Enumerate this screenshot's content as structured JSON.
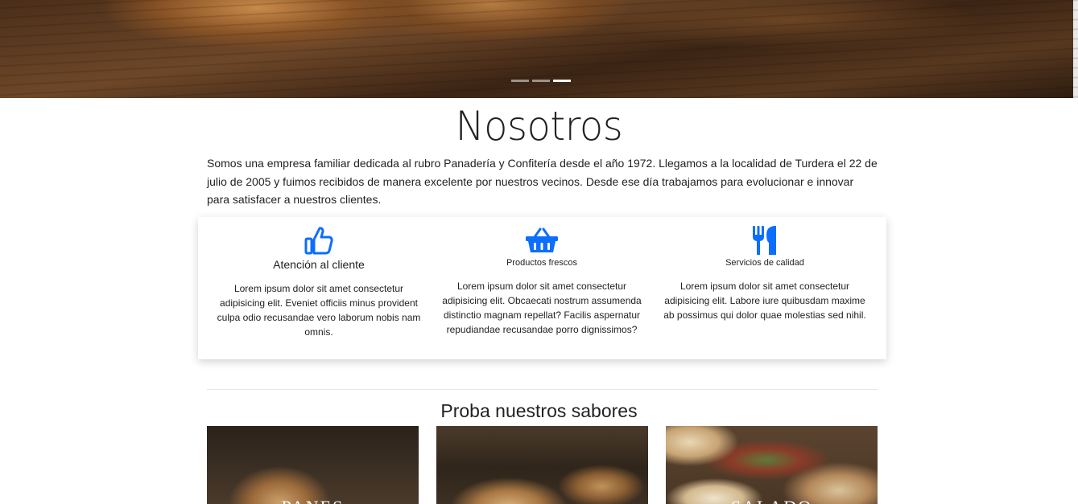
{
  "hero": {
    "indicators": [
      {
        "label": "slide-1",
        "active": false
      },
      {
        "label": "slide-2",
        "active": false
      },
      {
        "label": "slide-3",
        "active": true
      }
    ]
  },
  "about": {
    "title": "Nosotros",
    "text": "Somos una empresa familiar dedicada al rubro Panadería y Confitería desde el año 1972. Llegamos a la localidad de Turdera el 22 de julio de 2005 y fuimos recibidos de manera excelente por nuestros vecinos. Desde ese día trabajamos para evolucionar e innovar para satisfacer a nuestros clientes."
  },
  "features": [
    {
      "icon": "thumbs-up-icon",
      "title": "Atención al cliente",
      "text": "Lorem ipsum dolor sit amet consectetur adipisicing elit. Eveniet officiis minus provident culpa odio recusandae vero laborum nobis nam omnis."
    },
    {
      "icon": "basket-icon",
      "title": "Productos frescos",
      "text": "Lorem ipsum dolor sit amet consectetur adipisicing elit. Obcaecati nostrum assumenda distinctio magnam repellat? Facilis aspernatur repudiandae recusandae porro dignissimos?"
    },
    {
      "icon": "utensils-icon",
      "title": "Servicios de calidad",
      "text": "Lorem ipsum dolor sit amet consectetur adipisicing elit. Labore iure quibusdam maxime ab possimus qui dolor quae molestias sed nihil."
    }
  ],
  "flavors": {
    "title": "Proba nuestros sabores",
    "cards": [
      {
        "label": "PANES"
      },
      {
        "label": ""
      },
      {
        "label": "SALADO"
      }
    ]
  },
  "colors": {
    "accent": "#0d6efd"
  }
}
